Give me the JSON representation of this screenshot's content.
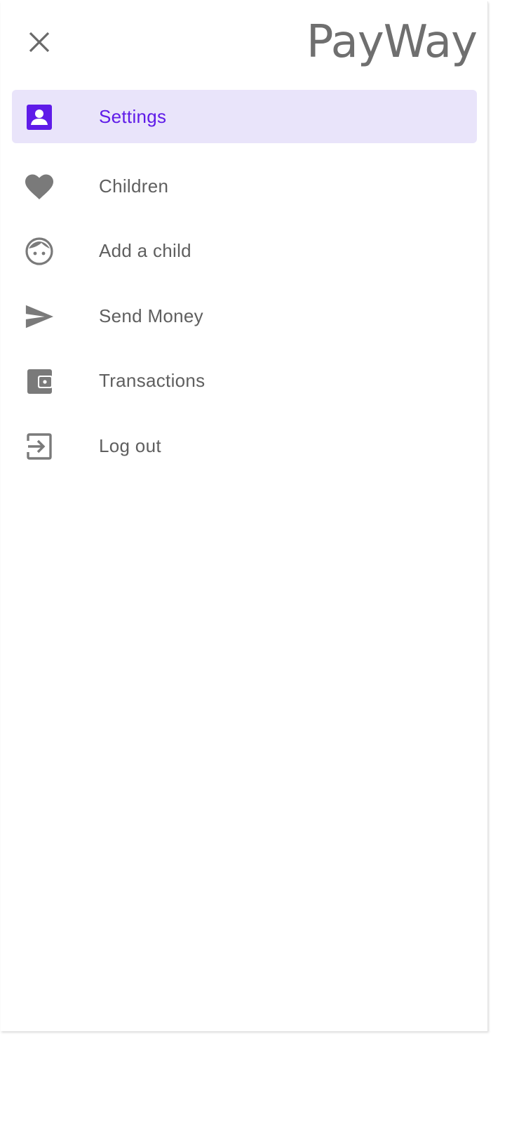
{
  "app": {
    "brand": "PayWay"
  },
  "colors": {
    "accent": "#5f1be8",
    "active_bg": "#e9e4fa",
    "icon_gray": "#7a7a7a",
    "text_gray": "#5f5f5f"
  },
  "menu": {
    "items": [
      {
        "label": "Settings",
        "icon": "account-box-icon",
        "active": true
      },
      {
        "label": "Children",
        "icon": "heart-icon",
        "active": false
      },
      {
        "label": "Add a child",
        "icon": "child-face-icon",
        "active": false
      },
      {
        "label": "Send Money",
        "icon": "send-icon",
        "active": false
      },
      {
        "label": "Transactions",
        "icon": "wallet-icon",
        "active": false
      },
      {
        "label": "Log out",
        "icon": "logout-icon",
        "active": false
      }
    ]
  }
}
